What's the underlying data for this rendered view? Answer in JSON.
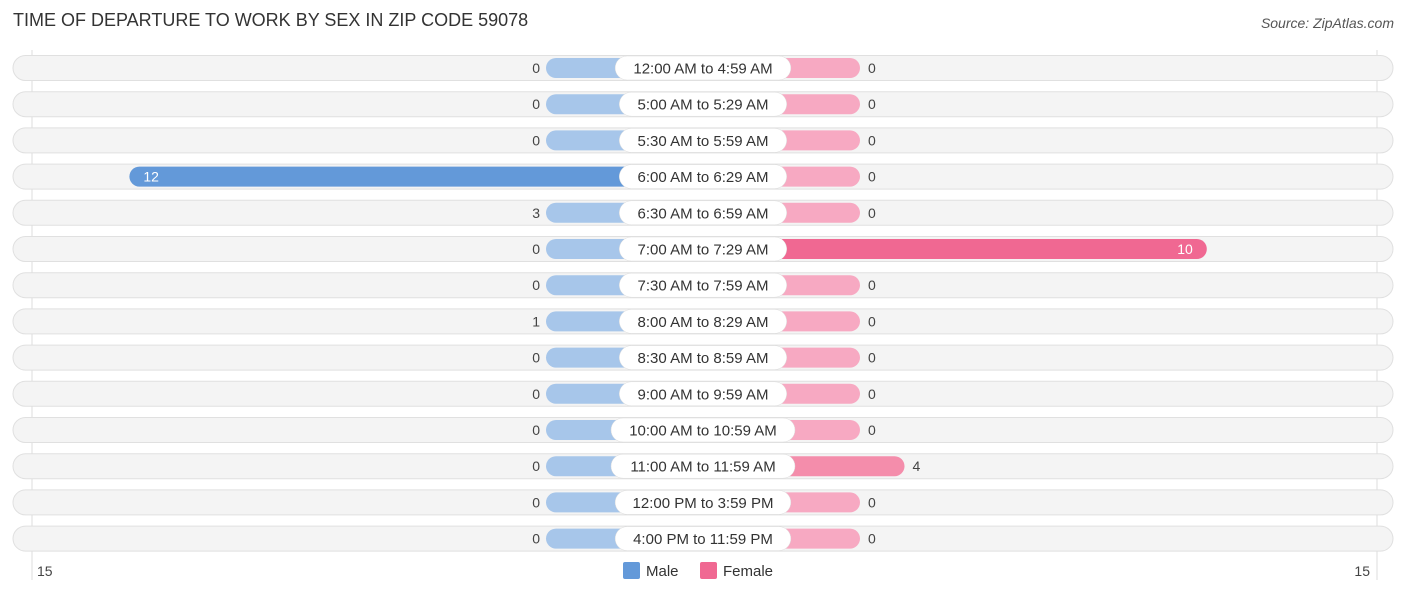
{
  "chart_data": {
    "type": "bar",
    "title": "TIME OF DEPARTURE TO WORK BY SEX IN ZIP CODE 59078",
    "source": "Source: ZipAtlas.com",
    "categories": [
      "12:00 AM to 4:59 AM",
      "5:00 AM to 5:29 AM",
      "5:30 AM to 5:59 AM",
      "6:00 AM to 6:29 AM",
      "6:30 AM to 6:59 AM",
      "7:00 AM to 7:29 AM",
      "7:30 AM to 7:59 AM",
      "8:00 AM to 8:29 AM",
      "8:30 AM to 8:59 AM",
      "9:00 AM to 9:59 AM",
      "10:00 AM to 10:59 AM",
      "11:00 AM to 11:59 AM",
      "12:00 PM to 3:59 PM",
      "4:00 PM to 11:59 PM"
    ],
    "series": [
      {
        "name": "Male",
        "color": "#6399d9",
        "values": [
          0,
          0,
          0,
          12,
          3,
          0,
          0,
          1,
          0,
          0,
          0,
          0,
          0,
          0
        ]
      },
      {
        "name": "Female",
        "color": "#f06892",
        "values": [
          0,
          0,
          0,
          0,
          0,
          10,
          0,
          0,
          0,
          0,
          0,
          4,
          0,
          0
        ]
      }
    ],
    "axis": {
      "left_label": "15",
      "right_label": "15",
      "max": 15
    },
    "legend": [
      "Male",
      "Female"
    ],
    "legend_position": "bottom-center"
  }
}
